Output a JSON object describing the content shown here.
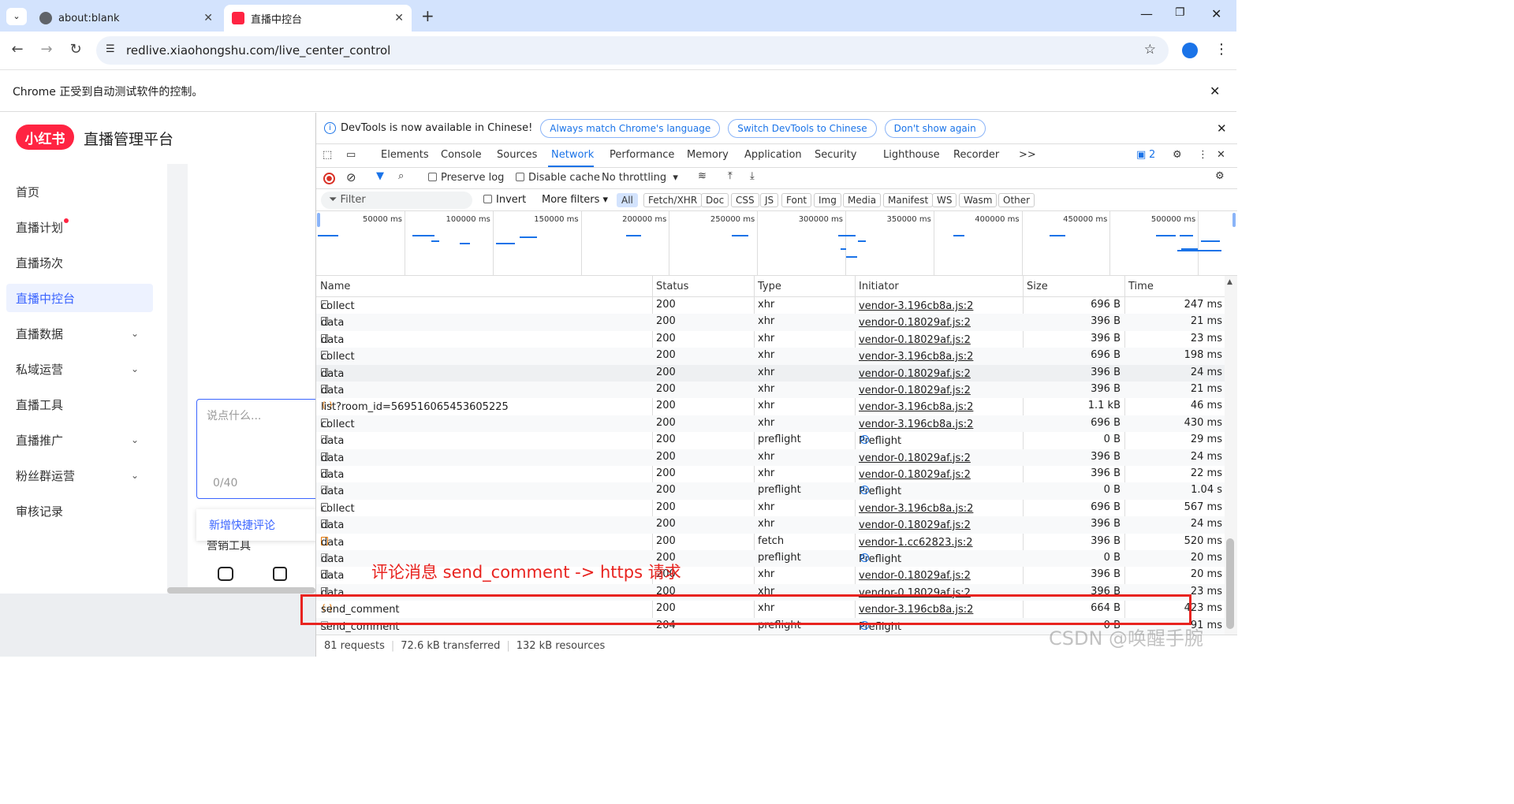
{
  "browser": {
    "tabs": [
      {
        "title": "about:blank",
        "active": false
      },
      {
        "title": "直播中控台",
        "active": true
      }
    ],
    "new_tab": "+",
    "address": "redlive.xiaohongshu.com/live_center_control",
    "infobar": "Chrome 正受到自动测试软件的控制。"
  },
  "app": {
    "logo": "小红书",
    "brand": "直播管理平台",
    "menu": [
      {
        "label": "首页"
      },
      {
        "label": "直播计划"
      },
      {
        "label": "直播场次"
      },
      {
        "label": "直播中控台"
      },
      {
        "label": "直播数据"
      },
      {
        "label": "私域运营"
      },
      {
        "label": "直播工具"
      },
      {
        "label": "直播推广"
      },
      {
        "label": "粉丝群运营"
      },
      {
        "label": "审核记录"
      }
    ],
    "comment_placeholder": "说点什么...",
    "comment_counter": "0/40",
    "quick_comment": "新增快捷评论",
    "marketing_tools": "营销工具"
  },
  "devtools": {
    "banner": "DevTools is now available in Chinese!",
    "banner_buttons": [
      "Always match Chrome's language",
      "Switch DevTools to Chinese",
      "Don't show again"
    ],
    "tabs": [
      "Elements",
      "Console",
      "Sources",
      "Network",
      "Performance",
      "Memory",
      "Application",
      "Security",
      "Lighthouse",
      "Recorder"
    ],
    "more_tabs": ">>",
    "badge": "2",
    "toolbar": {
      "preserve_log": "Preserve log",
      "disable_cache": "Disable cache",
      "throttling": "No throttling"
    },
    "filter": {
      "placeholder": "Filter",
      "invert": "Invert",
      "more_filters": "More filters",
      "types": [
        "All",
        "Fetch/XHR",
        "Doc",
        "CSS",
        "JS",
        "Font",
        "Img",
        "Media",
        "Manifest",
        "WS",
        "Wasm",
        "Other"
      ]
    },
    "timeline_ticks": [
      "50000 ms",
      "100000 ms",
      "150000 ms",
      "200000 ms",
      "250000 ms",
      "300000 ms",
      "350000 ms",
      "400000 ms",
      "450000 ms",
      "500000 ms"
    ],
    "columns": [
      "Name",
      "Status",
      "Type",
      "Initiator",
      "Size",
      "Time"
    ],
    "rows": [
      {
        "name": "collect",
        "icon": "doc",
        "status": "200",
        "type": "xhr",
        "initiator": "vendor-3.196cb8a.js:2",
        "size": "696 B",
        "time": "247 ms"
      },
      {
        "name": "data",
        "icon": "doc",
        "status": "200",
        "type": "xhr",
        "initiator": "vendor-0.18029af.js:2",
        "size": "396 B",
        "time": "21 ms"
      },
      {
        "name": "data",
        "icon": "doc",
        "status": "200",
        "type": "xhr",
        "initiator": "vendor-0.18029af.js:2",
        "size": "396 B",
        "time": "23 ms"
      },
      {
        "name": "collect",
        "icon": "doc",
        "status": "200",
        "type": "xhr",
        "initiator": "vendor-3.196cb8a.js:2",
        "size": "696 B",
        "time": "198 ms"
      },
      {
        "name": "data",
        "icon": "doc",
        "status": "200",
        "type": "xhr",
        "initiator": "vendor-0.18029af.js:2",
        "size": "396 B",
        "time": "24 ms"
      },
      {
        "name": "data",
        "icon": "doc",
        "status": "200",
        "type": "xhr",
        "initiator": "vendor-0.18029af.js:2",
        "size": "396 B",
        "time": "21 ms"
      },
      {
        "name": "list?room_id=569516065453605225",
        "icon": "xhr",
        "status": "200",
        "type": "xhr",
        "initiator": "vendor-3.196cb8a.js:2",
        "size": "1.1 kB",
        "time": "46 ms"
      },
      {
        "name": "collect",
        "icon": "doc",
        "status": "200",
        "type": "xhr",
        "initiator": "vendor-3.196cb8a.js:2",
        "size": "696 B",
        "time": "430 ms"
      },
      {
        "name": "data",
        "icon": "blank",
        "status": "200",
        "type": "preflight",
        "initiator": "Preflight",
        "size": "0 B",
        "time": "29 ms"
      },
      {
        "name": "data",
        "icon": "doc",
        "status": "200",
        "type": "xhr",
        "initiator": "vendor-0.18029af.js:2",
        "size": "396 B",
        "time": "24 ms"
      },
      {
        "name": "data",
        "icon": "doc",
        "status": "200",
        "type": "xhr",
        "initiator": "vendor-0.18029af.js:2",
        "size": "396 B",
        "time": "22 ms"
      },
      {
        "name": "data",
        "icon": "blank",
        "status": "200",
        "type": "preflight",
        "initiator": "Preflight",
        "size": "0 B",
        "time": "1.04 s"
      },
      {
        "name": "collect",
        "icon": "doc",
        "status": "200",
        "type": "xhr",
        "initiator": "vendor-3.196cb8a.js:2",
        "size": "696 B",
        "time": "567 ms"
      },
      {
        "name": "data",
        "icon": "doc",
        "status": "200",
        "type": "xhr",
        "initiator": "vendor-0.18029af.js:2",
        "size": "396 B",
        "time": "24 ms"
      },
      {
        "name": "data",
        "icon": "fetch",
        "status": "200",
        "type": "fetch",
        "initiator": "vendor-1.cc62823.js:2",
        "size": "396 B",
        "time": "520 ms"
      },
      {
        "name": "data",
        "icon": "blank",
        "status": "200",
        "type": "preflight",
        "initiator": "Preflight",
        "size": "0 B",
        "time": "20 ms"
      },
      {
        "name": "data",
        "icon": "doc",
        "status": "200",
        "type": "xhr",
        "initiator": "vendor-0.18029af.js:2",
        "size": "396 B",
        "time": "20 ms"
      },
      {
        "name": "data",
        "icon": "doc",
        "status": "200",
        "type": "xhr",
        "initiator": "vendor-0.18029af.js:2",
        "size": "396 B",
        "time": "23 ms"
      },
      {
        "name": "send_comment",
        "icon": "xhr",
        "status": "200",
        "type": "xhr",
        "initiator": "vendor-3.196cb8a.js:2",
        "size": "664 B",
        "time": "423 ms"
      },
      {
        "name": "send_comment",
        "icon": "blank",
        "status": "204",
        "type": "preflight",
        "initiator": "Preflight",
        "size": "0 B",
        "time": "91 ms"
      }
    ],
    "status_bar": [
      "81 requests",
      "72.6 kB transferred",
      "132 kB resources"
    ]
  },
  "annotation": "评论消息 send_comment -> https 请求",
  "watermark": "CSDN @唤醒手腕",
  "colors": {
    "accent": "#1a73e8",
    "brand": "#ff2442",
    "annotation": "#e8231f"
  }
}
